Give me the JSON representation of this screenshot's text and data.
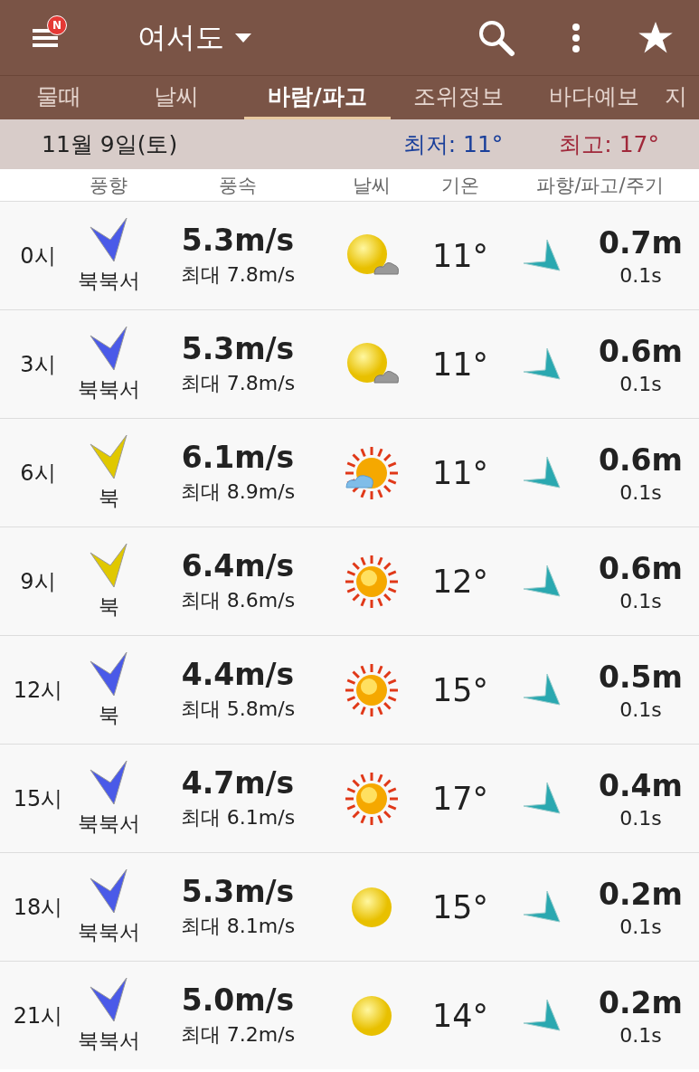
{
  "app_bar": {
    "title": "여서도",
    "badge": "N"
  },
  "tabs": [
    {
      "label": "물때",
      "selected": false
    },
    {
      "label": "날씨",
      "selected": false
    },
    {
      "label": "바람/파고",
      "selected": true
    },
    {
      "label": "조위정보",
      "selected": false
    },
    {
      "label": "바다예보",
      "selected": false
    },
    {
      "label": "지",
      "selected": false
    }
  ],
  "date_bar": {
    "date": "11월 9일(토)",
    "low": "최저: 11°",
    "high": "최고: 17°"
  },
  "columns": [
    "풍향",
    "풍속",
    "날씨",
    "기온",
    "파향/파고/주기"
  ],
  "rows": [
    {
      "time": "0시",
      "direction": "북북서",
      "color": "#4a5ae8",
      "speed": "5.3m/s",
      "max": "최대 7.8m/s",
      "kind": "sun_cloud",
      "temp": "11°",
      "wave": "0.7m",
      "period": "0.1s"
    },
    {
      "time": "3시",
      "direction": "북북서",
      "color": "#4a5ae8",
      "speed": "5.3m/s",
      "max": "최대 7.8m/s",
      "kind": "sun_cloud",
      "temp": "11°",
      "wave": "0.6m",
      "period": "0.1s"
    },
    {
      "time": "6시",
      "direction": "북",
      "color": "#e0c800",
      "speed": "6.1m/s",
      "max": "최대 8.9m/s",
      "kind": "rays_cloud",
      "temp": "11°",
      "wave": "0.6m",
      "period": "0.1s"
    },
    {
      "time": "9시",
      "direction": "북",
      "color": "#e0c800",
      "speed": "6.4m/s",
      "max": "최대 8.6m/s",
      "kind": "rays",
      "temp": "12°",
      "wave": "0.6m",
      "period": "0.1s"
    },
    {
      "time": "12시",
      "direction": "북",
      "color": "#4a5ae8",
      "speed": "4.4m/s",
      "max": "최대 5.8m/s",
      "kind": "rays",
      "temp": "15°",
      "wave": "0.5m",
      "period": "0.1s"
    },
    {
      "time": "15시",
      "direction": "북북서",
      "color": "#4a5ae8",
      "speed": "4.7m/s",
      "max": "최대 6.1m/s",
      "kind": "rays",
      "temp": "17°",
      "wave": "0.4m",
      "period": "0.1s"
    },
    {
      "time": "18시",
      "direction": "북북서",
      "color": "#4a5ae8",
      "speed": "5.3m/s",
      "max": "최대 8.1m/s",
      "kind": "sun",
      "temp": "15°",
      "wave": "0.2m",
      "period": "0.1s"
    },
    {
      "time": "21시",
      "direction": "북북서",
      "color": "#4a5ae8",
      "speed": "5.0m/s",
      "max": "최대 7.2m/s",
      "kind": "sun",
      "temp": "14°",
      "wave": "0.2m",
      "period": "0.1s"
    }
  ]
}
